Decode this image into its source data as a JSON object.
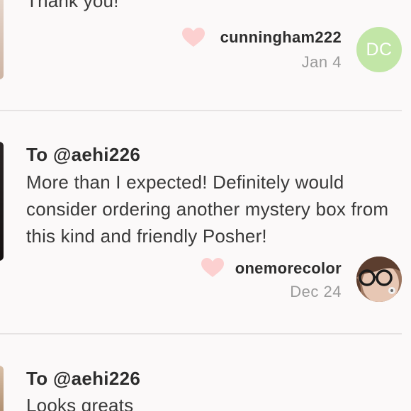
{
  "feed": {
    "partial_top": {
      "text": "Thank you!"
    },
    "reviews": [
      {
        "user": "cunningham222",
        "date": "Jan 4",
        "avatar_initials": "DC"
      },
      {
        "to": "To @aehi226",
        "text": "More than I expected! Definitely would consider ordering another mystery box from this kind and friendly Posher!",
        "user": "onemorecolor",
        "date": "Dec 24"
      },
      {
        "to": "To @aehi226",
        "text": "Looks greats"
      }
    ]
  },
  "colors": {
    "heart": "#fcd0d0",
    "avatar_green": "#c2e6a7",
    "divider": "#e6e3e3",
    "date_gray": "#9a9a9a"
  },
  "icons": {
    "like": "heart-icon"
  }
}
